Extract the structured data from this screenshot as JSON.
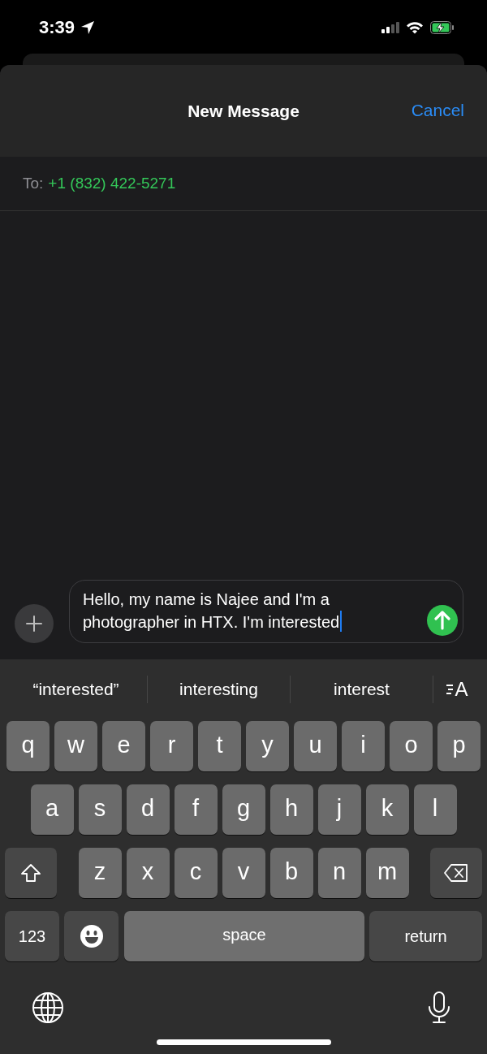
{
  "status_bar": {
    "time": "3:39"
  },
  "header": {
    "title": "New Message",
    "cancel": "Cancel"
  },
  "recipient": {
    "label": "To:",
    "value": "+1 (832) 422-5271"
  },
  "compose": {
    "value": "Hello, my name is Najee and I'm a photographer in HTX. I'm interested"
  },
  "suggestions": [
    {
      "text": "“interested”"
    },
    {
      "text": "interesting"
    },
    {
      "text": "interest"
    }
  ],
  "text_format_key": {
    "label": "A"
  },
  "keyboard": {
    "rows": [
      {
        "keys": [
          {
            "kind": "letter",
            "label": "q"
          },
          {
            "kind": "letter",
            "label": "w"
          },
          {
            "kind": "letter",
            "label": "e"
          },
          {
            "kind": "letter",
            "label": "r"
          },
          {
            "kind": "letter",
            "label": "t"
          },
          {
            "kind": "letter",
            "label": "y"
          },
          {
            "kind": "letter",
            "label": "u"
          },
          {
            "kind": "letter",
            "label": "i"
          },
          {
            "kind": "letter",
            "label": "o"
          },
          {
            "kind": "letter",
            "label": "p"
          }
        ]
      },
      {
        "keys": [
          {
            "kind": "letter",
            "label": "a"
          },
          {
            "kind": "letter",
            "label": "s"
          },
          {
            "kind": "letter",
            "label": "d"
          },
          {
            "kind": "letter",
            "label": "f"
          },
          {
            "kind": "letter",
            "label": "g"
          },
          {
            "kind": "letter",
            "label": "h"
          },
          {
            "kind": "letter",
            "label": "j"
          },
          {
            "kind": "letter",
            "label": "k"
          },
          {
            "kind": "letter",
            "label": "l"
          }
        ]
      },
      {
        "keys": [
          {
            "kind": "shift",
            "on": false
          },
          {
            "kind": "letter",
            "label": "z"
          },
          {
            "kind": "letter",
            "label": "x"
          },
          {
            "kind": "letter",
            "label": "c"
          },
          {
            "kind": "letter",
            "label": "v"
          },
          {
            "kind": "letter",
            "label": "b"
          },
          {
            "kind": "letter",
            "label": "n"
          },
          {
            "kind": "letter",
            "label": "m"
          },
          {
            "kind": "delete"
          }
        ]
      },
      {
        "keys": [
          {
            "kind": "numbers",
            "label": "123"
          },
          {
            "kind": "emoji"
          },
          {
            "kind": "space",
            "label": "space"
          },
          {
            "kind": "return",
            "label": "return"
          }
        ]
      }
    ]
  }
}
